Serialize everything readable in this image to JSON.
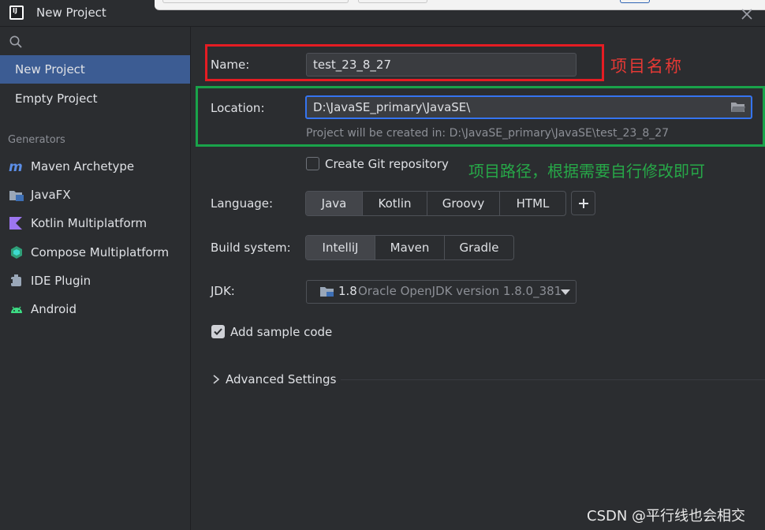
{
  "window": {
    "title": "New Project"
  },
  "sidebar": {
    "items": [
      {
        "label": "New Project"
      },
      {
        "label": "Empty Project"
      }
    ],
    "generators_title": "Generators",
    "generators": [
      {
        "label": "Maven Archetype",
        "icon": "maven-icon"
      },
      {
        "label": "JavaFX",
        "icon": "javafx-icon"
      },
      {
        "label": "Kotlin Multiplatform",
        "icon": "kotlin-icon"
      },
      {
        "label": "Compose Multiplatform",
        "icon": "compose-icon"
      },
      {
        "label": "IDE Plugin",
        "icon": "plugin-icon"
      },
      {
        "label": "Android",
        "icon": "android-icon"
      }
    ]
  },
  "form": {
    "name_label": "Name:",
    "name_value": "test_23_8_27",
    "location_label": "Location:",
    "location_value": "D:\\JavaSE_primary\\JavaSE\\",
    "location_hint": "Project will be created in: D:\\JavaSE_primary\\JavaSE\\test_23_8_27",
    "git_label": "Create Git repository",
    "git_checked": false,
    "language_label": "Language:",
    "languages": [
      "Java",
      "Kotlin",
      "Groovy",
      "HTML"
    ],
    "language_selected": "Java",
    "build_label": "Build system:",
    "build_systems": [
      "IntelliJ",
      "Maven",
      "Gradle"
    ],
    "build_selected": "IntelliJ",
    "jdk_label": "JDK:",
    "jdk_version": "1.8",
    "jdk_description": "Oracle OpenJDK version 1.8.0_381",
    "sample_code_label": "Add sample code",
    "sample_code_checked": true,
    "advanced_label": "Advanced Settings"
  },
  "annotations": {
    "name_note": "项目名称",
    "location_note": "项目路径，根据需要自行修改即可",
    "red_color": "#e51c23",
    "green_color": "#19a34a"
  },
  "watermark": "CSDN @平行线也会相交",
  "colors": {
    "background": "#2b2d30",
    "accent": "#3574f0",
    "selected_sidebar": "#3c5c93"
  }
}
